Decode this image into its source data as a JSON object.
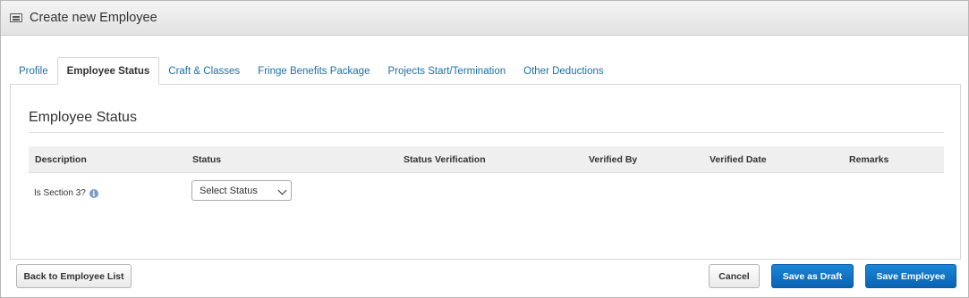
{
  "header": {
    "title": "Create new Employee",
    "icon": "list-window-icon"
  },
  "tabs": [
    {
      "label": "Profile",
      "active": false
    },
    {
      "label": "Employee Status",
      "active": true
    },
    {
      "label": "Craft & Classes",
      "active": false
    },
    {
      "label": "Fringe Benefits Package",
      "active": false
    },
    {
      "label": "Projects Start/Termination",
      "active": false
    },
    {
      "label": "Other Deductions",
      "active": false
    }
  ],
  "section": {
    "title": "Employee Status"
  },
  "table": {
    "columns": [
      "Description",
      "Status",
      "Status Verification",
      "Verified By",
      "Verified Date",
      "Remarks"
    ],
    "rows": [
      {
        "description": "Is Section 3?",
        "status": "Select Status"
      }
    ]
  },
  "buttons": {
    "back": "Back to Employee List",
    "cancel": "Cancel",
    "save_draft": "Save as Draft",
    "save_employee": "Save Employee"
  },
  "colors": {
    "accent": "#0b63b3",
    "link": "#1d6fa5"
  }
}
